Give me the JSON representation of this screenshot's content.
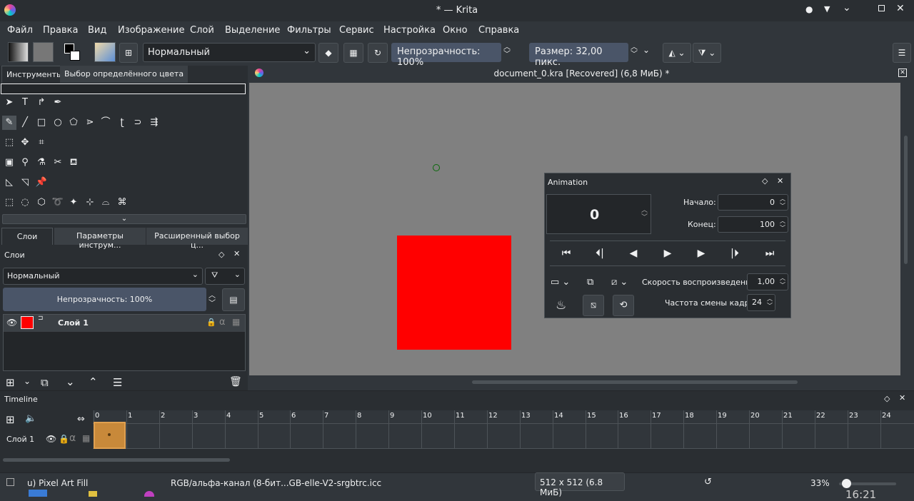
{
  "window": {
    "title": "* — Krita"
  },
  "menu": [
    "Файл",
    "Правка",
    "Вид",
    "Изображение",
    "Слой",
    "Выделение",
    "Фильтры",
    "Сервис",
    "Настройка",
    "Окно",
    "Справка"
  ],
  "toolbar": {
    "blend_mode": "Нормальный",
    "opacity_label": "Непрозрачность: 100%",
    "size_label": "Размер: 32,00 пикс."
  },
  "left_tabs": {
    "tools": "Инструменты",
    "color_selector": "Выбор определённого цвета"
  },
  "layer_tabs": {
    "layers": "Слои",
    "tool_options": "Параметры инструм...",
    "advanced_color": "Расширенный выбор ц..."
  },
  "layers_panel": {
    "title": "Слои",
    "blend_mode": "Нормальный",
    "opacity_label": "Непрозрачность:  100%",
    "layer_name": "Слой 1",
    "layer_color": "#ff0000"
  },
  "document": {
    "tab_title": "document_0.kra [Recovered]  (6,8 МиБ) *"
  },
  "canvas": {
    "fill_color": "#ff0000"
  },
  "animation": {
    "title": "Animation",
    "current_frame": "0",
    "start_label": "Начало:",
    "start_value": "0",
    "end_label": "Конец:",
    "end_value": "100",
    "speed_label": "Скорость воспроизведения:",
    "speed_value": "1,00",
    "fps_label": "Частота смены кадра:",
    "fps_value": "24"
  },
  "timeline": {
    "title": "Timeline",
    "layer_name": "Слой 1",
    "frames": [
      "0",
      "1",
      "2",
      "3",
      "4",
      "5",
      "6",
      "7",
      "8",
      "9",
      "10",
      "11",
      "12",
      "13",
      "14",
      "15",
      "16",
      "17",
      "18",
      "19",
      "20",
      "21",
      "22",
      "23",
      "24"
    ]
  },
  "status": {
    "brush": "u) Pixel Art Fill",
    "color_space": "RGB/альфа-канал (8-бит...GB-elle-V2-srgbtrc.icc",
    "dimensions": "512 x 512 (6.8 МиБ)",
    "zoom": "33%",
    "clock": "16:21"
  }
}
